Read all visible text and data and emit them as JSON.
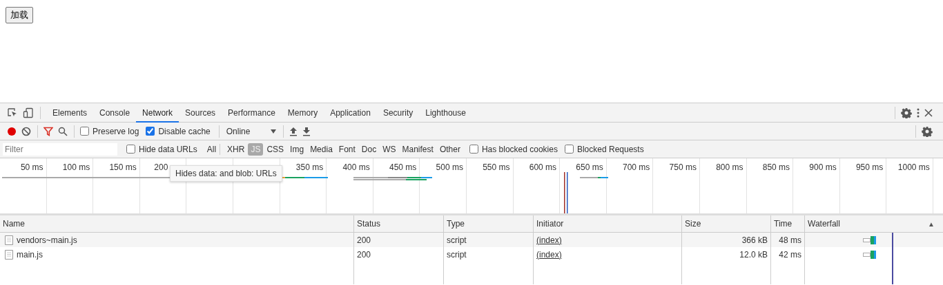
{
  "page": {
    "load_button": "加载"
  },
  "devtools": {
    "tabs": [
      {
        "label": "Elements",
        "selected": false
      },
      {
        "label": "Console",
        "selected": false
      },
      {
        "label": "Network",
        "selected": true
      },
      {
        "label": "Sources",
        "selected": false
      },
      {
        "label": "Performance",
        "selected": false
      },
      {
        "label": "Memory",
        "selected": false
      },
      {
        "label": "Application",
        "selected": false
      },
      {
        "label": "Security",
        "selected": false
      },
      {
        "label": "Lighthouse",
        "selected": false
      }
    ],
    "toolbar": {
      "recording": true,
      "preserve_log": {
        "label": "Preserve log",
        "checked": false
      },
      "disable_cache": {
        "label": "Disable cache",
        "checked": true
      },
      "throttling": "Online"
    },
    "filter_bar": {
      "placeholder": "Filter",
      "hide_data_urls": {
        "label": "Hide data URLs",
        "checked": false
      },
      "types": [
        {
          "label": "All",
          "selected": false
        },
        {
          "label": "XHR",
          "selected": false
        },
        {
          "label": "JS",
          "selected": true
        },
        {
          "label": "CSS",
          "selected": false
        },
        {
          "label": "Img",
          "selected": false
        },
        {
          "label": "Media",
          "selected": false
        },
        {
          "label": "Font",
          "selected": false
        },
        {
          "label": "Doc",
          "selected": false
        },
        {
          "label": "WS",
          "selected": false
        },
        {
          "label": "Manifest",
          "selected": false
        },
        {
          "label": "Other",
          "selected": false
        }
      ],
      "has_blocked_cookies": {
        "label": "Has blocked cookies",
        "checked": false
      },
      "blocked_requests": {
        "label": "Blocked Requests",
        "checked": false
      }
    },
    "overview": {
      "ticks": [
        {
          "kind": "full",
          "label": "50 ms"
        },
        {
          "label": "100 ms",
          "kind": "full"
        },
        {
          "label": "150 ms",
          "kind": "full"
        },
        {
          "label": "200",
          "kind": "partial"
        },
        {
          "kind": "covered"
        },
        {
          "kind": "covered"
        },
        {
          "label": "350 ms"
        },
        {
          "label": "400 ms"
        },
        {
          "label": "450 ms"
        },
        {
          "label": "500 ms"
        },
        {
          "label": "550 ms"
        },
        {
          "label": "600 ms"
        },
        {
          "label": "650 ms"
        },
        {
          "label": "700 ms"
        },
        {
          "label": "750 ms"
        },
        {
          "label": "800 ms"
        },
        {
          "label": "850 ms"
        },
        {
          "label": "900 ms"
        },
        {
          "label": "950 ms"
        },
        {
          "label": "1000 ms"
        }
      ],
      "tooltip": "Hides data: and blob: URLs"
    },
    "table": {
      "columns": [
        "Name",
        "Status",
        "Type",
        "Initiator",
        "Size",
        "Time",
        "Waterfall"
      ],
      "sort_indicator": "▲",
      "rows": [
        {
          "name": "vendors~main.js",
          "status": "200",
          "type": "script",
          "initiator": "(index)",
          "size": "366 kB",
          "time": "48 ms"
        },
        {
          "name": "main.js",
          "status": "200",
          "type": "script",
          "initiator": "(index)",
          "size": "12.0 kB",
          "time": "42 ms"
        }
      ]
    }
  }
}
